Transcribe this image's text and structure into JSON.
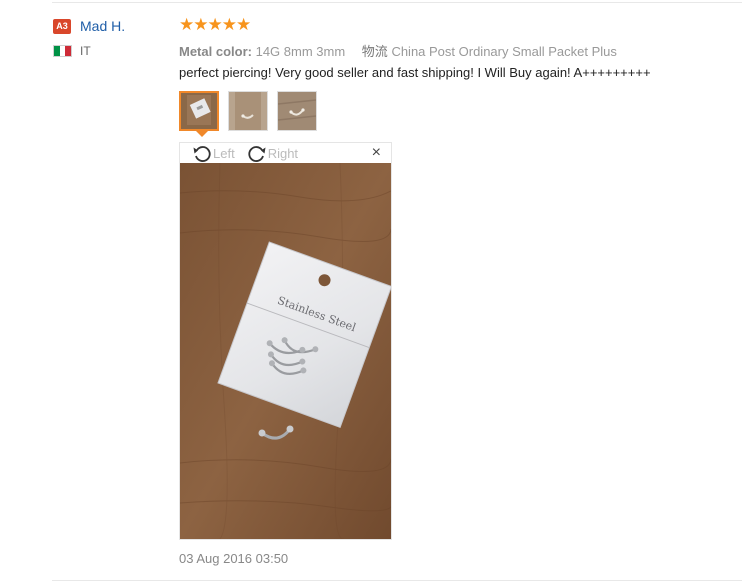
{
  "buyer": {
    "level": "A3",
    "name": "Mad H.",
    "country": "IT",
    "flag_colors": [
      "#009246",
      "#ffffff",
      "#ce2b37"
    ]
  },
  "feedback": {
    "rating": 5,
    "metal_color_label": "Metal color:",
    "metal_color_value": "14G 8mm 3mm",
    "shipping_label": "物流",
    "shipping_value": "China Post Ordinary Small Packet Plus",
    "text": "perfect piercing! Very good seller and fast shipping! I Will Buy again! A+++++++++",
    "date": "03 Aug 2016 03:50"
  },
  "viewer": {
    "rotate_left_label": "Left",
    "rotate_right_label": "Right",
    "close_symbol": "×"
  },
  "packet": {
    "label": "Stainless Steel"
  },
  "colors": {
    "accent_orange": "#f0882a",
    "star": "#f7941d",
    "name_link": "#1f5ea8",
    "level_badge": "#d9472b"
  }
}
